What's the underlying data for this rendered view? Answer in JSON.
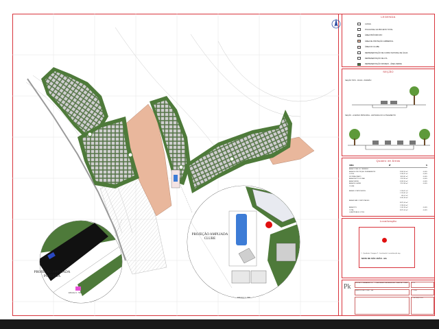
{
  "sheet": {
    "legend_title": "LEGENDA",
    "legend_items": [
      {
        "label": "COTAS",
        "color": "#ffffff",
        "icon": "dot-icon"
      },
      {
        "label": "POLIGONAL DA PROJETO TOTAL",
        "color": "#ffffff",
        "icon": "polygon-outline-icon"
      },
      {
        "label": "ÁREA PRÓXIMO RIO",
        "color": "#ffffff",
        "icon": "hatch-icon"
      },
      {
        "label": "ÁREA DE PROTEÇÃO AMBIENTAL",
        "color": "#e9b79c",
        "icon": "swatch-icon"
      },
      {
        "label": "ÁREA DO CLUBE",
        "color": "#f3e3e3",
        "icon": "swatch-icon"
      },
      {
        "label": "REPRESENTAÇÃO DE CURSO NATURAL DE ÁGUA",
        "color": "#ffffff",
        "icon": "line-icon"
      },
      {
        "label": "REPRESENTAÇÃO DE LTA",
        "color": "#ffffff",
        "icon": "dashed-line-icon"
      },
      {
        "label": "REPRESENTAÇÃO PASSEIO - ÁREA VERDE",
        "color": "#4e7a3a",
        "icon": "swatch-icon"
      }
    ],
    "section_title": "SEÇÃO",
    "section_a_label": "SEÇÃO TIPO - RUAS - PADRÃO",
    "section_b_label": "SEÇÃO - ACESSO PRINCIPAL - ENTRADA DO LOTEAMENTO",
    "table_title": "Quadro de Áreas",
    "table_header": [
      "ÁREA",
      "M²",
      "%"
    ],
    "table_rows": [
      [
        "ÁREA TOTAL DO TERRENO",
        "",
        ""
      ],
      [
        "ÁREA DE PROTEÇÃO PERMANENTE",
        "3.962,00 m²",
        "0,00%"
      ],
      [
        "LOTES",
        "1.265,21 m²",
        "0,00%"
      ],
      [
        "SISTEMA VIÁRIO",
        "365.541 m²",
        "0,00%"
      ],
      [
        "ÁREA INSTITUCIONAL",
        "123.254 m²",
        "0,00%"
      ],
      [
        "ÁREA VERDE",
        "6.362,00 m²",
        "0,00%"
      ],
      [
        "ÁREA DE LAZER",
        "225.148 m²",
        "0,00%"
      ],
      [
        "CLUBE",
        "",
        ""
      ],
      [
        "",
        "",
        ""
      ],
      [
        "ÁREAS COMPUTÁVEIS",
        "1.156,11 m²",
        ""
      ],
      [
        "",
        "1.114,41 m²",
        ""
      ],
      [
        "",
        "135,12 m²",
        ""
      ],
      [
        "",
        "1.001,36 m²",
        ""
      ],
      [
        "ÁREAS NÃO COMPUTÁVEIS",
        "",
        ""
      ],
      [
        "",
        "9.871,00 m²",
        ""
      ],
      [
        "",
        "1.265,00 m²",
        ""
      ],
      [
        "ÁREA ÚTIL",
        "1.101,36 m²",
        "0,00%"
      ],
      [
        "TOTAL",
        "9.871,00 m²",
        "0,00%"
      ],
      [
        "QUANTIDADE LOTES",
        "",
        ""
      ]
    ],
    "location_title": "Localização",
    "location_line": "1 - Quadrante / Imagem    2 - Localização / centralização img",
    "location_place": "MATA DE SÃO JOÃO - BA",
    "titleblock_logo": "Pk",
    "titleblock_project": "PROJETO URBANÍSTICO - CONDOMÍNIO RESIDENCIAL CASA DA TORRE",
    "titleblock_client": "MATA DE SÃO JOÃO - BA",
    "titleblock_sheet": "01/01",
    "titleblock_scale": "1 : 1000",
    "titleblock_date": "1º de março 2021",
    "map_labels": {
      "projection_porter": "PROJEÇÃO AMPLIADA PORTARIA",
      "projection_club": "PROJEÇÃO AMPLIADA CLUBE",
      "scale_a": "ESCALA 1 : 500",
      "scale_b": "ESCALA 1 : 500"
    },
    "colors": {
      "frame": "#d8323a",
      "road_green": "#4e7a3a",
      "lot_gray": "#bcbcbc",
      "protection": "#e9b79c",
      "hatch": "#d0d0d0"
    }
  }
}
